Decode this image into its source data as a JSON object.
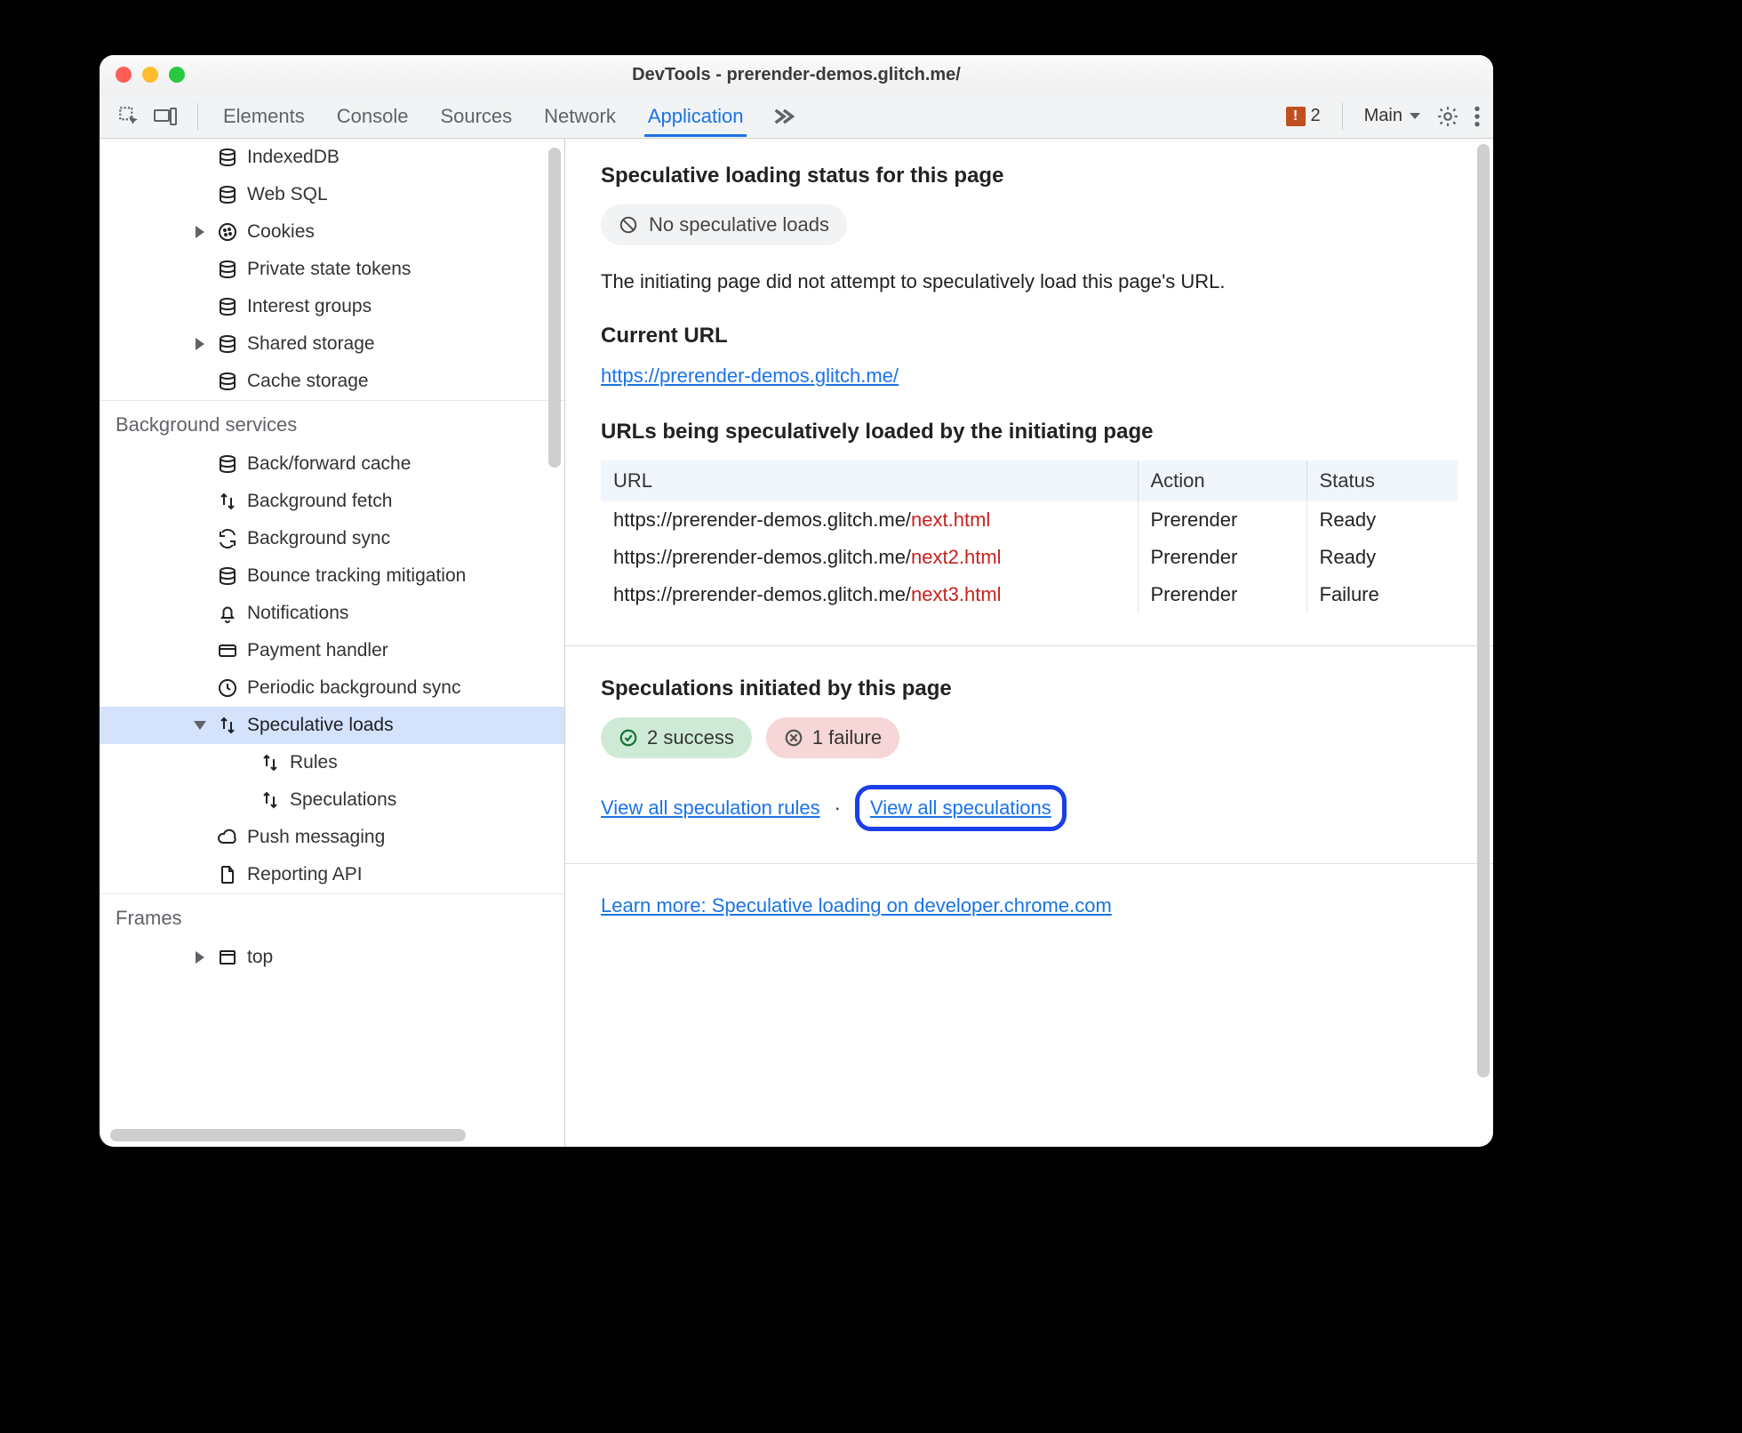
{
  "window_title": "DevTools - prerender-demos.glitch.me/",
  "tabs": {
    "elements": "Elements",
    "console": "Console",
    "sources": "Sources",
    "network": "Network",
    "application": "Application"
  },
  "warnings_count": "2",
  "target_label": "Main",
  "sidebar": {
    "storage": [
      "IndexedDB",
      "Web SQL",
      "Cookies",
      "Private state tokens",
      "Interest groups",
      "Shared storage",
      "Cache storage"
    ],
    "bg_label": "Background services",
    "bg": [
      "Back/forward cache",
      "Background fetch",
      "Background sync",
      "Bounce tracking mitigation",
      "Notifications",
      "Payment handler",
      "Periodic background sync",
      "Speculative loads",
      "Rules",
      "Speculations",
      "Push messaging",
      "Reporting API"
    ],
    "frames_label": "Frames",
    "frames": [
      "top"
    ]
  },
  "main": {
    "status_heading": "Speculative loading status for this page",
    "no_loads": "No speculative loads",
    "description": "The initiating page did not attempt to speculatively load this page's URL.",
    "current_url_label": "Current URL",
    "current_url": "https://prerender-demos.glitch.me/",
    "urls_heading": "URLs being speculatively loaded by the initiating page",
    "table": {
      "headers": {
        "url": "URL",
        "action": "Action",
        "status": "Status"
      },
      "rows": [
        {
          "prefix": "https://prerender-demos.glitch.me/",
          "suffix": "next.html",
          "action": "Prerender",
          "status": "Ready"
        },
        {
          "prefix": "https://prerender-demos.glitch.me/",
          "suffix": "next2.html",
          "action": "Prerender",
          "status": "Ready"
        },
        {
          "prefix": "https://prerender-demos.glitch.me/",
          "suffix": "next3.html",
          "action": "Prerender",
          "status": "Failure"
        }
      ]
    },
    "speculations_heading": "Speculations initiated by this page",
    "success_badge": "2 success",
    "failure_badge": "1 failure",
    "view_rules": "View all speculation rules",
    "view_speculations": "View all speculations",
    "dot": "·",
    "learn_more": "Learn more: Speculative loading on developer.chrome.com"
  }
}
